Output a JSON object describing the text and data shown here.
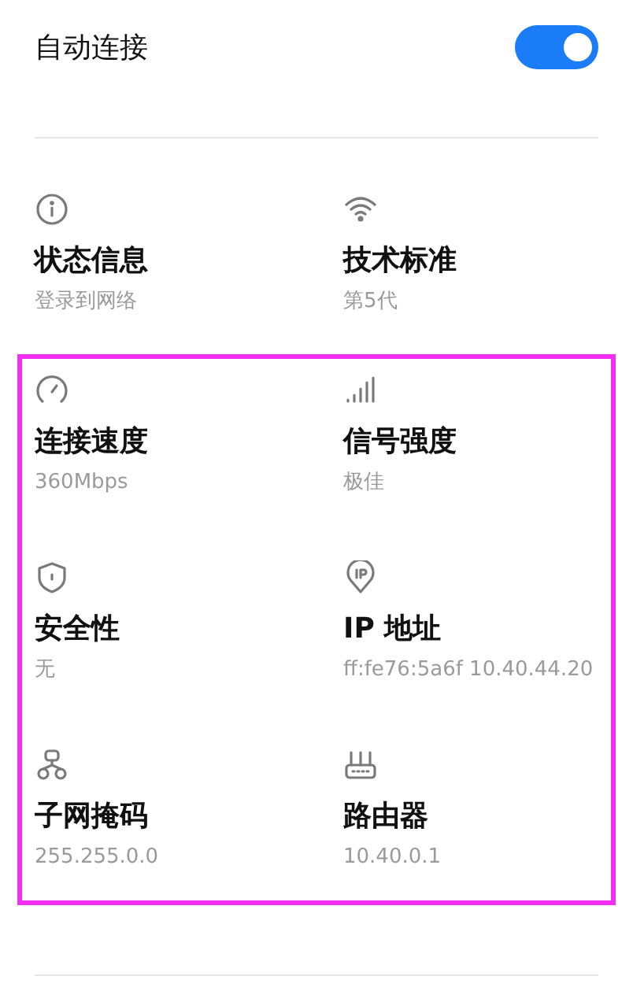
{
  "auto_connect": {
    "label": "自动连接",
    "on": true
  },
  "sections": [
    {
      "kind": "plain",
      "items": [
        {
          "kind": "info",
          "title": "状态信息",
          "value": "登录到网络"
        },
        {
          "kind": "wifi",
          "title": "技术标准",
          "value": "第5代"
        }
      ]
    },
    {
      "kind": "highlighted",
      "items": [
        {
          "kind": "speed",
          "title": "连接速度",
          "value": "360Mbps"
        },
        {
          "kind": "signal",
          "title": "信号强度",
          "value": "极佳"
        },
        {
          "kind": "shield",
          "title": "安全性",
          "value": "无"
        },
        {
          "kind": "ip",
          "title": "IP 地址",
          "value": "ff:fe76:5a6f 10.40.44.20"
        },
        {
          "kind": "subnet",
          "title": "子网掩码",
          "value": "255.255.0.0"
        },
        {
          "kind": "router",
          "title": "路由器",
          "value": "10.40.0.1"
        }
      ]
    }
  ]
}
